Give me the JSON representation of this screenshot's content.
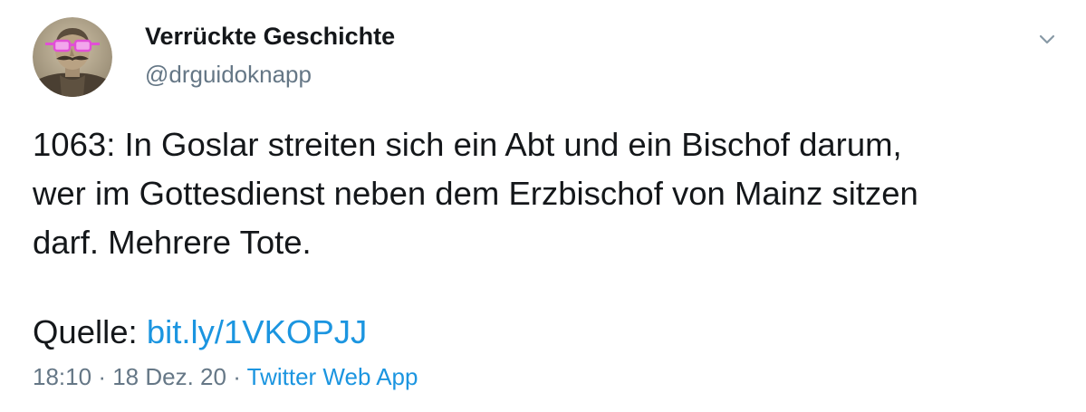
{
  "author": {
    "name": "Verrückte Geschichte",
    "handle": "@drguidoknapp"
  },
  "tweet": {
    "lines": [
      "1063: In Goslar streiten sich ein Abt und ein Bischof darum,",
      "wer im Gottesdienst neben dem Erzbischof von Mainz sitzen",
      "darf. Mehrere Tote."
    ],
    "source_label": "Quelle:",
    "source_link": "bit.ly/1VKOPJJ"
  },
  "meta": {
    "time": "18:10",
    "separator": "·",
    "date": "18 Dez. 20",
    "app": "Twitter Web App"
  },
  "icons": {
    "menu": "chevron-down-icon",
    "avatar": "portrait-with-pink-glasses"
  },
  "colors": {
    "link": "#1b95e0",
    "secondary_text": "#657786",
    "primary_text": "#14171a",
    "glasses": "#e14fd6"
  }
}
